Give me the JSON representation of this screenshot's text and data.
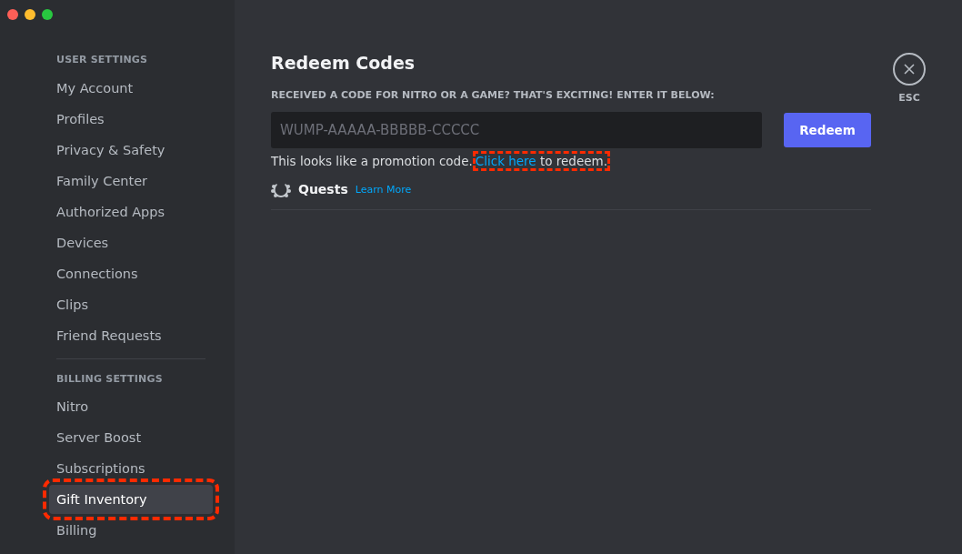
{
  "sidebar": {
    "sections": [
      {
        "header": "USER SETTINGS",
        "items": [
          {
            "label": "My Account",
            "selected": false,
            "highlighted": false
          },
          {
            "label": "Profiles",
            "selected": false,
            "highlighted": false
          },
          {
            "label": "Privacy & Safety",
            "selected": false,
            "highlighted": false
          },
          {
            "label": "Family Center",
            "selected": false,
            "highlighted": false
          },
          {
            "label": "Authorized Apps",
            "selected": false,
            "highlighted": false
          },
          {
            "label": "Devices",
            "selected": false,
            "highlighted": false
          },
          {
            "label": "Connections",
            "selected": false,
            "highlighted": false
          },
          {
            "label": "Clips",
            "selected": false,
            "highlighted": false
          },
          {
            "label": "Friend Requests",
            "selected": false,
            "highlighted": false
          }
        ]
      },
      {
        "header": "BILLING SETTINGS",
        "items": [
          {
            "label": "Nitro",
            "selected": false,
            "highlighted": false
          },
          {
            "label": "Server Boost",
            "selected": false,
            "highlighted": false
          },
          {
            "label": "Subscriptions",
            "selected": false,
            "highlighted": false
          },
          {
            "label": "Gift Inventory",
            "selected": true,
            "highlighted": true
          },
          {
            "label": "Billing",
            "selected": false,
            "highlighted": false
          }
        ]
      }
    ]
  },
  "main": {
    "title": "Redeem Codes",
    "field_label": "RECEIVED A CODE FOR NITRO OR A GAME? THAT'S EXCITING! ENTER IT BELOW:",
    "code_field": {
      "placeholder": "WUMP-AAAAA-BBBBB-CCCCC"
    },
    "redeem_button": "Redeem",
    "promo_message": {
      "before": "This looks like a promotion code.",
      "link": "Click here",
      "after": " to redeem.",
      "highlighted": true
    },
    "quests": {
      "label": "Quests",
      "link": "Learn More"
    }
  },
  "close_button": {
    "label": "ESC"
  }
}
